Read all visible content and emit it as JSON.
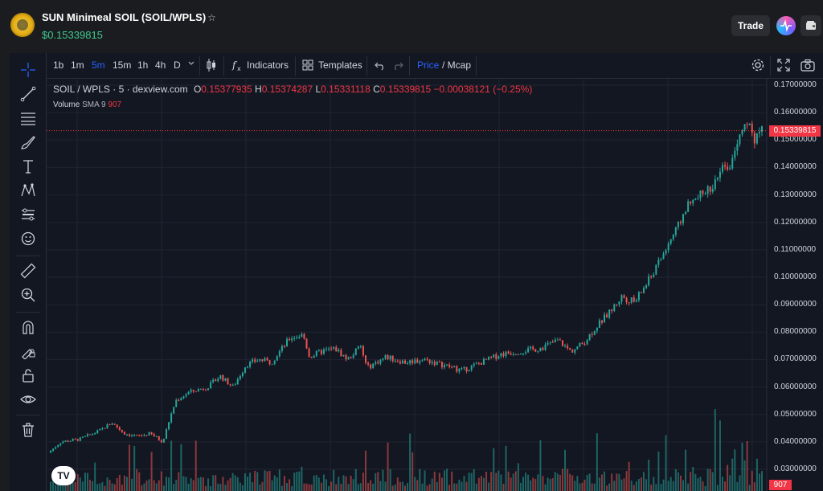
{
  "header": {
    "pair_title": "SUN Minimeal SOIL (SOIL/WPLS)",
    "star_glyph": "☆",
    "price": "$0.15339815",
    "trade_label": "Trade",
    "logo_icon": "token-logo",
    "pulse_icon": "pulsechain-icon",
    "wallet_icon": "wallet-icon"
  },
  "toolbar": {
    "intervals": [
      "1b",
      "1m",
      "5m",
      "15m",
      "1h",
      "4h",
      "D"
    ],
    "active_interval": "5m",
    "indicators_label": "Indicators",
    "templates_label": "Templates",
    "price_label": "Price",
    "mcap_label": "/ Mcap"
  },
  "legend": {
    "symbol": "SOIL / WPLS · 5 · dexview.com",
    "o_label": "O",
    "open": "0.15377935",
    "h_label": "H",
    "high": "0.15374287",
    "l_label": "L",
    "low": "0.15331118",
    "c_label": "C",
    "close": "0.15339815",
    "change": "−0.00038121 (−0.25%)",
    "volume_label": "Volume",
    "volume_sma": "SMA 9",
    "volume_value": "907"
  },
  "chart_data": {
    "type": "candlestick",
    "y_tick_labels": [
      "0.17000000",
      "0.16000000",
      "0.15000000",
      "0.14000000",
      "0.13000000",
      "0.12000000",
      "0.11000000",
      "0.10000000",
      "0.09000000",
      "0.08000000",
      "0.07000000",
      "0.06000000",
      "0.05000000",
      "0.04000000",
      "0.03000000"
    ],
    "ylim": [
      0.028,
      0.172
    ],
    "last_price": "0.15339815",
    "last_volume": "907",
    "price_path": [
      [
        0,
        0.036
      ],
      [
        0.02,
        0.04
      ],
      [
        0.05,
        0.041
      ],
      [
        0.08,
        0.044
      ],
      [
        0.1,
        0.047
      ],
      [
        0.12,
        0.043
      ],
      [
        0.14,
        0.042
      ],
      [
        0.16,
        0.043
      ],
      [
        0.18,
        0.04
      ],
      [
        0.19,
        0.048
      ],
      [
        0.2,
        0.055
      ],
      [
        0.22,
        0.058
      ],
      [
        0.25,
        0.06
      ],
      [
        0.27,
        0.064
      ],
      [
        0.29,
        0.06
      ],
      [
        0.31,
        0.068
      ],
      [
        0.33,
        0.07
      ],
      [
        0.35,
        0.069
      ],
      [
        0.36,
        0.072
      ],
      [
        0.38,
        0.078
      ],
      [
        0.4,
        0.079
      ],
      [
        0.41,
        0.071
      ],
      [
        0.43,
        0.073
      ],
      [
        0.45,
        0.074
      ],
      [
        0.47,
        0.07
      ],
      [
        0.49,
        0.075
      ],
      [
        0.5,
        0.067
      ],
      [
        0.53,
        0.071
      ],
      [
        0.56,
        0.069
      ],
      [
        0.59,
        0.07
      ],
      [
        0.62,
        0.068
      ],
      [
        0.65,
        0.066
      ],
      [
        0.68,
        0.069
      ],
      [
        0.71,
        0.072
      ],
      [
        0.74,
        0.073
      ],
      [
        0.77,
        0.074
      ],
      [
        0.8,
        0.077
      ],
      [
        0.82,
        0.073
      ],
      [
        0.84,
        0.076
      ],
      [
        0.86,
        0.082
      ],
      [
        0.88,
        0.087
      ],
      [
        0.9,
        0.093
      ],
      [
        0.92,
        0.091
      ],
      [
        0.94,
        0.098
      ],
      [
        0.96,
        0.106
      ],
      [
        0.975,
        0.113
      ],
      [
        0.99,
        0.119
      ],
      [
        1.0,
        0.125
      ]
    ],
    "price_path_tail": [
      [
        1.0,
        0.125
      ],
      [
        1.02,
        0.129
      ],
      [
        1.04,
        0.133
      ],
      [
        1.06,
        0.14
      ],
      [
        1.07,
        0.141
      ],
      [
        1.08,
        0.15
      ],
      [
        1.1,
        0.156
      ],
      [
        1.11,
        0.15
      ],
      [
        1.12,
        0.153
      ]
    ],
    "grid": true,
    "colors": {
      "up": "#26a69a",
      "down": "#ef5350",
      "last_price_line": "#f23645"
    }
  }
}
